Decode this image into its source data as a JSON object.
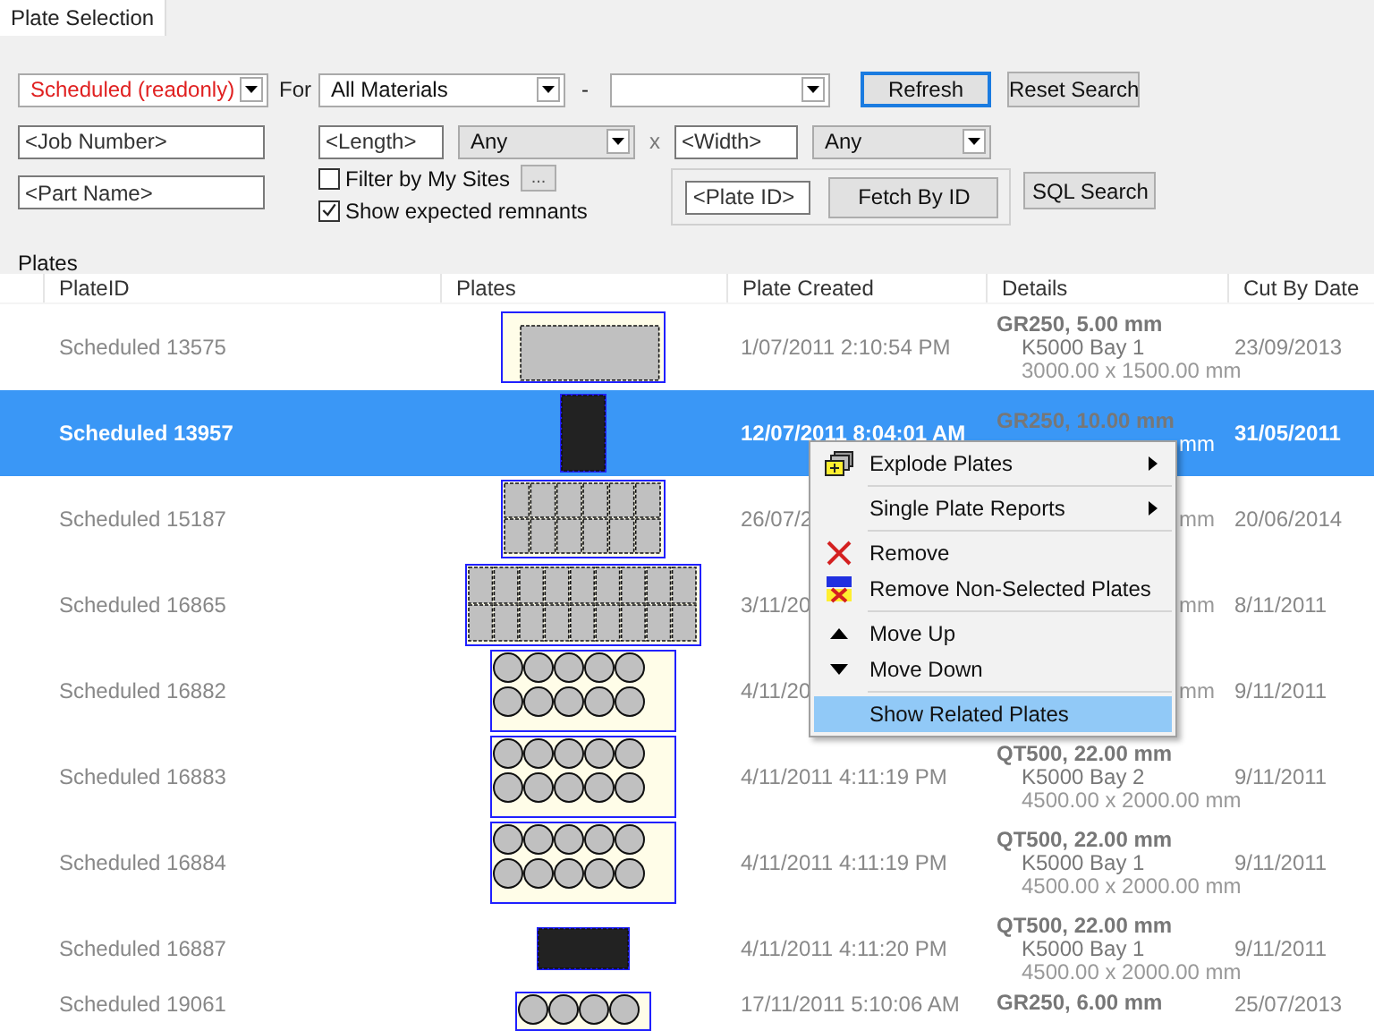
{
  "tab": {
    "label": "Plate Selection",
    "selected": true
  },
  "filters": {
    "status": {
      "value": "Scheduled (readonly)",
      "editable": true
    },
    "for_label": "For",
    "material": {
      "value": "All Materials",
      "editable": true
    },
    "range_dash": "-",
    "range_end": {
      "editable": true
    },
    "refresh": {
      "label": "Refresh",
      "focused": true
    },
    "reset": {
      "label": "Reset Search",
      "focused": false
    },
    "job_number": {
      "placeholder": "<Job Number>"
    },
    "length": {
      "placeholder": "<Length>"
    },
    "length_match": {
      "value": "Any",
      "editable": false
    },
    "times": "x",
    "width": {
      "placeholder": "<Width>"
    },
    "width_match": {
      "value": "Any",
      "editable": false
    },
    "part_name": {
      "placeholder": "<Part Name>"
    },
    "filter_my_sites": {
      "label": "Filter by My Sites",
      "checked": false
    },
    "sites_button": {
      "label": "..."
    },
    "show_remnants": {
      "label": "Show expected remnants",
      "checked": true
    },
    "plate_id": {
      "placeholder": "<Plate ID>"
    },
    "fetch": {
      "label": "Fetch By ID",
      "focused": false
    },
    "sql": {
      "label": "SQL Search",
      "focused": false
    }
  },
  "table": {
    "title": "Plates",
    "columns": [
      "PlateID",
      "Plates",
      "Plate Created",
      "Details",
      "Cut By Date"
    ],
    "rows": [
      {
        "plate_id": "Scheduled 13575",
        "created": "1/07/2011 2:10:54 PM",
        "cut_by": "23/09/2013",
        "selected": false,
        "details": [
          {
            "kind": "material",
            "text": "GR250, 5.00 mm"
          },
          {
            "kind": "location",
            "text": "K5000 Bay 1"
          },
          {
            "kind": "size",
            "text": "3000.00 x 1500.00 mm"
          }
        ]
      },
      {
        "plate_id": "Scheduled 13957",
        "created": "12/07/2011 8:04:01 AM",
        "cut_by": "31/05/2011",
        "selected": true,
        "details": [
          {
            "kind": "material",
            "text": "GR250, 10.00 mm"
          },
          {
            "kind": "tail",
            "text": "mm"
          }
        ]
      },
      {
        "plate_id": "Scheduled 15187",
        "created": "26/07/2",
        "cut_by": "20/06/2014",
        "selected": false,
        "details": [
          {
            "kind": "tail",
            "text": "mm"
          }
        ]
      },
      {
        "plate_id": "Scheduled 16865",
        "created": "3/11/20",
        "cut_by": "8/11/2011",
        "selected": false,
        "details": [
          {
            "kind": "tail",
            "text": "mm"
          }
        ]
      },
      {
        "plate_id": "Scheduled 16882",
        "created": "4/11/20",
        "cut_by": "9/11/2011",
        "selected": false,
        "details": [
          {
            "kind": "tail",
            "text": "mm"
          }
        ]
      },
      {
        "plate_id": "Scheduled 16883",
        "created": "4/11/2011 4:11:19 PM",
        "cut_by": "9/11/2011",
        "selected": false,
        "details": [
          {
            "kind": "material",
            "text": "QT500, 22.00 mm"
          },
          {
            "kind": "location",
            "text": "K5000 Bay 2"
          },
          {
            "kind": "size",
            "text": "4500.00 x 2000.00 mm"
          }
        ]
      },
      {
        "plate_id": "Scheduled 16884",
        "created": "4/11/2011 4:11:19 PM",
        "cut_by": "9/11/2011",
        "selected": false,
        "details": [
          {
            "kind": "material",
            "text": "QT500, 22.00 mm"
          },
          {
            "kind": "location",
            "text": "K5000 Bay 1"
          },
          {
            "kind": "size",
            "text": "4500.00 x 2000.00 mm"
          }
        ]
      },
      {
        "plate_id": "Scheduled 16887",
        "created": "4/11/2011 4:11:20 PM",
        "cut_by": "9/11/2011",
        "selected": false,
        "details": [
          {
            "kind": "material",
            "text": "QT500, 22.00 mm"
          },
          {
            "kind": "location",
            "text": "K5000 Bay 1"
          },
          {
            "kind": "size",
            "text": "4500.00 x 2000.00 mm"
          }
        ]
      },
      {
        "plate_id": "Scheduled 19061",
        "created": "17/11/2011 5:10:06 AM",
        "cut_by": "25/07/2013",
        "selected": false,
        "details": [
          {
            "kind": "material",
            "text": "GR250, 6.00 mm"
          }
        ]
      }
    ]
  },
  "context_menu": {
    "items": [
      {
        "kind": "item",
        "label": "Explode Plates",
        "submenu": true,
        "selected": false
      },
      {
        "kind": "separator"
      },
      {
        "kind": "item",
        "label": "Single Plate Reports",
        "submenu": true,
        "selected": false
      },
      {
        "kind": "separator"
      },
      {
        "kind": "item",
        "label": "Remove",
        "submenu": false,
        "selected": false
      },
      {
        "kind": "item",
        "label": "Remove Non-Selected Plates",
        "submenu": false,
        "selected": false
      },
      {
        "kind": "separator"
      },
      {
        "kind": "item",
        "label": "Move Up",
        "submenu": false,
        "selected": false
      },
      {
        "kind": "item",
        "label": "Move Down",
        "submenu": false,
        "selected": false
      },
      {
        "kind": "separator"
      },
      {
        "kind": "item",
        "label": "Show Related Plates",
        "submenu": false,
        "selected": true
      }
    ]
  }
}
